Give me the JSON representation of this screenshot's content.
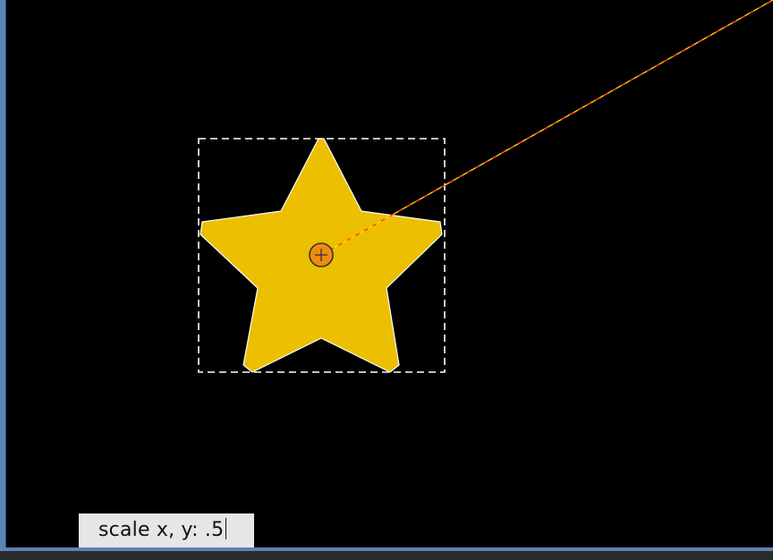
{
  "canvas": {
    "background": "#000000",
    "frame_color": "#5b82b8"
  },
  "shape": {
    "type": "star",
    "points": 5,
    "fill": "#ecbf00",
    "stroke": "#ffffff",
    "selected": true
  },
  "pivot": {
    "icon": "crosshair-circle-icon",
    "fill": "#f08a12",
    "stroke": "#333333"
  },
  "guide_line": {
    "color_a": "#ffd200",
    "color_b": "#ff3b1f",
    "style": "dashed"
  },
  "command_input": {
    "value": "scale x, y: .5"
  }
}
